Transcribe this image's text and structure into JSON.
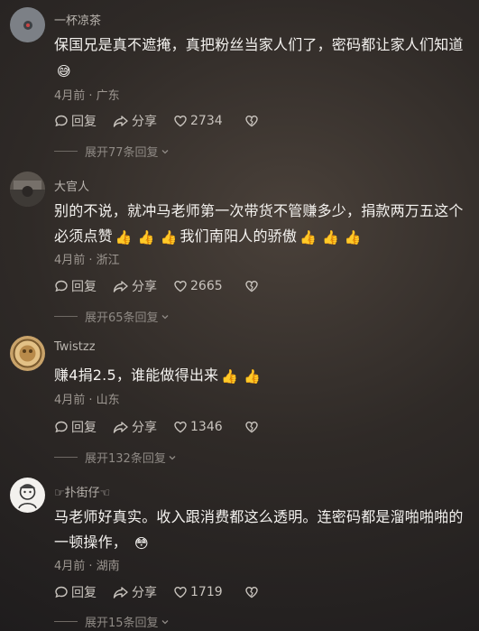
{
  "comments": [
    {
      "username": "一杯凉茶",
      "text": "保国兄是真不遮掩，真把粉丝当家人们了，密码都让家人们知道",
      "emoji": "😅",
      "meta": "4月前 · 广东",
      "reply_label": "回复",
      "share_label": "分享",
      "likes": "2734",
      "expand_label": "展开77条回复"
    },
    {
      "username": "大官人",
      "text_a": "别的不说，就冲马老师第一次带货不管赚多少，捐款两万五这个必须点赞",
      "emoji": "👍",
      "text_b": "我们南阳人的骄傲",
      "meta": "4月前 · 浙江",
      "reply_label": "回复",
      "share_label": "分享",
      "likes": "2665",
      "expand_label": "展开65条回复"
    },
    {
      "username": "Twistzz",
      "text": "赚4捐2.5，谁能做得出来",
      "emoji": "👍",
      "meta": "4月前 · 山东",
      "reply_label": "回复",
      "share_label": "分享",
      "likes": "1346",
      "expand_label": "展开132条回复"
    },
    {
      "username": "☞扑街仔☜",
      "text": "马老师好真实。收入跟消费都这么透明。连密码都是溜啪啪啪的一顿操作，",
      "emoji": "😳",
      "meta": "4月前 · 湖南",
      "reply_label": "回复",
      "share_label": "分享",
      "likes": "1719",
      "expand_label": "展开15条回复"
    }
  ],
  "icons": {
    "reply": "reply-bubble-icon",
    "share": "share-arrow-icon",
    "like": "heart-icon",
    "dislike": "broken-heart-icon",
    "expand": "chevron-down-icon"
  }
}
